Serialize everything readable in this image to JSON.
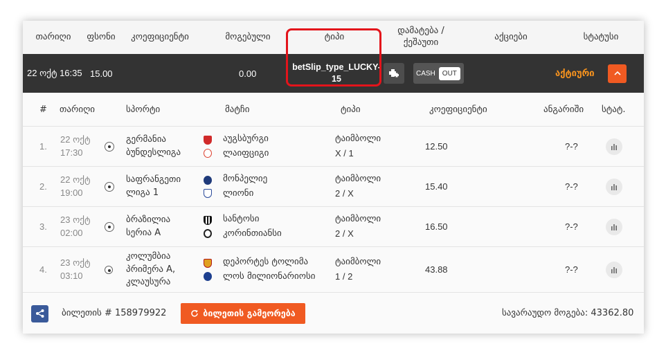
{
  "header": {
    "date": "თარიღი",
    "price": "ფსონი",
    "coefficient": "კოეფიციენტი",
    "winning": "მოგებული",
    "type": "ტიპი",
    "bonus": "დამატება / ქეშაუთი",
    "actions": "აქციები",
    "status": "სტატუსი"
  },
  "bet": {
    "date": "22 ოქტ 16:35",
    "stake": "15.00",
    "winning": "0.00",
    "type": "betSlip_type_LUCKY-15",
    "cash_label": "CASH",
    "out_label": "OUT",
    "status": "აქტიური"
  },
  "columns": {
    "num": "#",
    "date": "თარიღი",
    "sport": "სპორტი",
    "match": "მატჩი",
    "type": "ტიპი",
    "coefficient": "კოეფიციენტი",
    "score": "ანგარიში",
    "stat": "სტატ."
  },
  "rows": [
    {
      "num": "1.",
      "date1": "22 ოქტ",
      "date2": "17:30",
      "league": "გერმანია ბუნდესლიგა",
      "team1": "აუგსბურგი",
      "team2": "ლაიფციგი",
      "type1": "ტაიმბოლი",
      "type2": "X / 1",
      "odds": "12.50",
      "score": "?-?"
    },
    {
      "num": "2.",
      "date1": "22 ოქტ",
      "date2": "19:00",
      "league": "საფრანგეთი ლიგა 1",
      "team1": "მონპელიე",
      "team2": "ლიონი",
      "type1": "ტაიმბოლი",
      "type2": "2 / X",
      "odds": "15.40",
      "score": "?-?"
    },
    {
      "num": "3.",
      "date1": "23 ოქტ",
      "date2": "02:00",
      "league": "ბრაზილია სერია A",
      "team1": "სანტოსი",
      "team2": "კორინთიანსი",
      "type1": "ტაიმბოლი",
      "type2": "2 / X",
      "odds": "16.50",
      "score": "?-?"
    },
    {
      "num": "4.",
      "date1": "23 ოქტ",
      "date2": "03:10",
      "league": "კოლუმბია პრიმერა A, კლაუსურა",
      "team1": "დეპორტეს ტოლიმა",
      "team2": "ლოს მილიონარიოსი",
      "type1": "ტაიმბოლი",
      "type2": "1 / 2",
      "odds": "43.88",
      "score": "?-?"
    }
  ],
  "footer": {
    "ticket": "ბილეთის # 158979922",
    "repeat_button": "ბილეთის გამეორება",
    "possible_win": "სავარაუდო მოგება: 43362.80"
  },
  "colors": {
    "accent": "#f05a22",
    "dark_row": "#333333",
    "status_active": "#f7931e",
    "share_button": "#3a5a9a",
    "highlight": "#e3141b"
  },
  "icons": {
    "sport": "soccer-ball-icon",
    "stat": "bar-chart-icon",
    "share": "share-icon",
    "repeat": "refresh-icon",
    "expand": "chevron-up-icon",
    "combo": "plus-combo-icon"
  }
}
